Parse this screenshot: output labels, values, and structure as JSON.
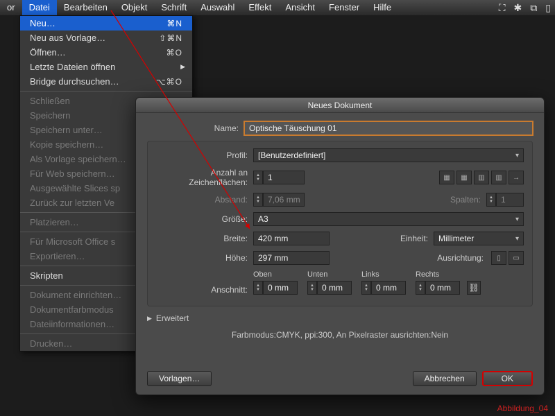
{
  "menubar": {
    "items": [
      "Datei",
      "Bearbeiten",
      "Objekt",
      "Schrift",
      "Auswahl",
      "Effekt",
      "Ansicht",
      "Fenster",
      "Hilfe"
    ]
  },
  "dropdown": {
    "neu": "Neu…",
    "neu_sc": "⌘N",
    "neu_vorlage": "Neu aus Vorlage…",
    "neu_vorlage_sc": "⇧⌘N",
    "oeffnen": "Öffnen…",
    "oeffnen_sc": "⌘O",
    "letzte": "Letzte Dateien öffnen",
    "bridge": "Bridge durchsuchen…",
    "bridge_sc": "⌥⌘O",
    "schliessen": "Schließen",
    "speichern": "Speichern",
    "speichern_unter": "Speichern unter…",
    "kopie": "Kopie speichern…",
    "als_vorlage": "Als Vorlage speichern…",
    "fuer_web": "Für Web speichern…",
    "slices": "Ausgewählte Slices sp",
    "zurueck": "Zurück zur letzten Ve",
    "platzieren": "Platzieren…",
    "ms_office": "Für Microsoft Office s",
    "exportieren": "Exportieren…",
    "skripten": "Skripten",
    "dokument_einrichten": "Dokument einrichten…",
    "farbmodus": "Dokumentfarbmodus",
    "dateiinfo": "Dateiinformationen…",
    "drucken": "Drucken…"
  },
  "dialog": {
    "title": "Neues Dokument",
    "name_lbl": "Name:",
    "name_val": "Optische Täuschung 01",
    "profil_lbl": "Profil:",
    "profil_val": "[Benutzerdefiniert]",
    "artboards_lbl": "Anzahl an Zeichenflächen:",
    "artboards_val": "1",
    "abstand_lbl": "Abstand:",
    "abstand_val": "7,06 mm",
    "spalten_lbl": "Spalten:",
    "spalten_val": "1",
    "groesse_lbl": "Größe:",
    "groesse_val": "A3",
    "breite_lbl": "Breite:",
    "breite_val": "420 mm",
    "einheit_lbl": "Einheit:",
    "einheit_val": "Millimeter",
    "hoehe_lbl": "Höhe:",
    "hoehe_val": "297 mm",
    "ausrichtung_lbl": "Ausrichtung:",
    "anschnitt_lbl": "Anschnitt:",
    "oben": "Oben",
    "unten": "Unten",
    "links": "Links",
    "rechts": "Rechts",
    "bleed_val": "0 mm",
    "erweitert": "Erweitert",
    "footer": "Farbmodus:CMYK, ppi:300, An Pixelraster ausrichten:Nein",
    "vorlagen_btn": "Vorlagen…",
    "abbrechen_btn": "Abbrechen",
    "ok_btn": "OK"
  },
  "caption": "Abbildung_04"
}
